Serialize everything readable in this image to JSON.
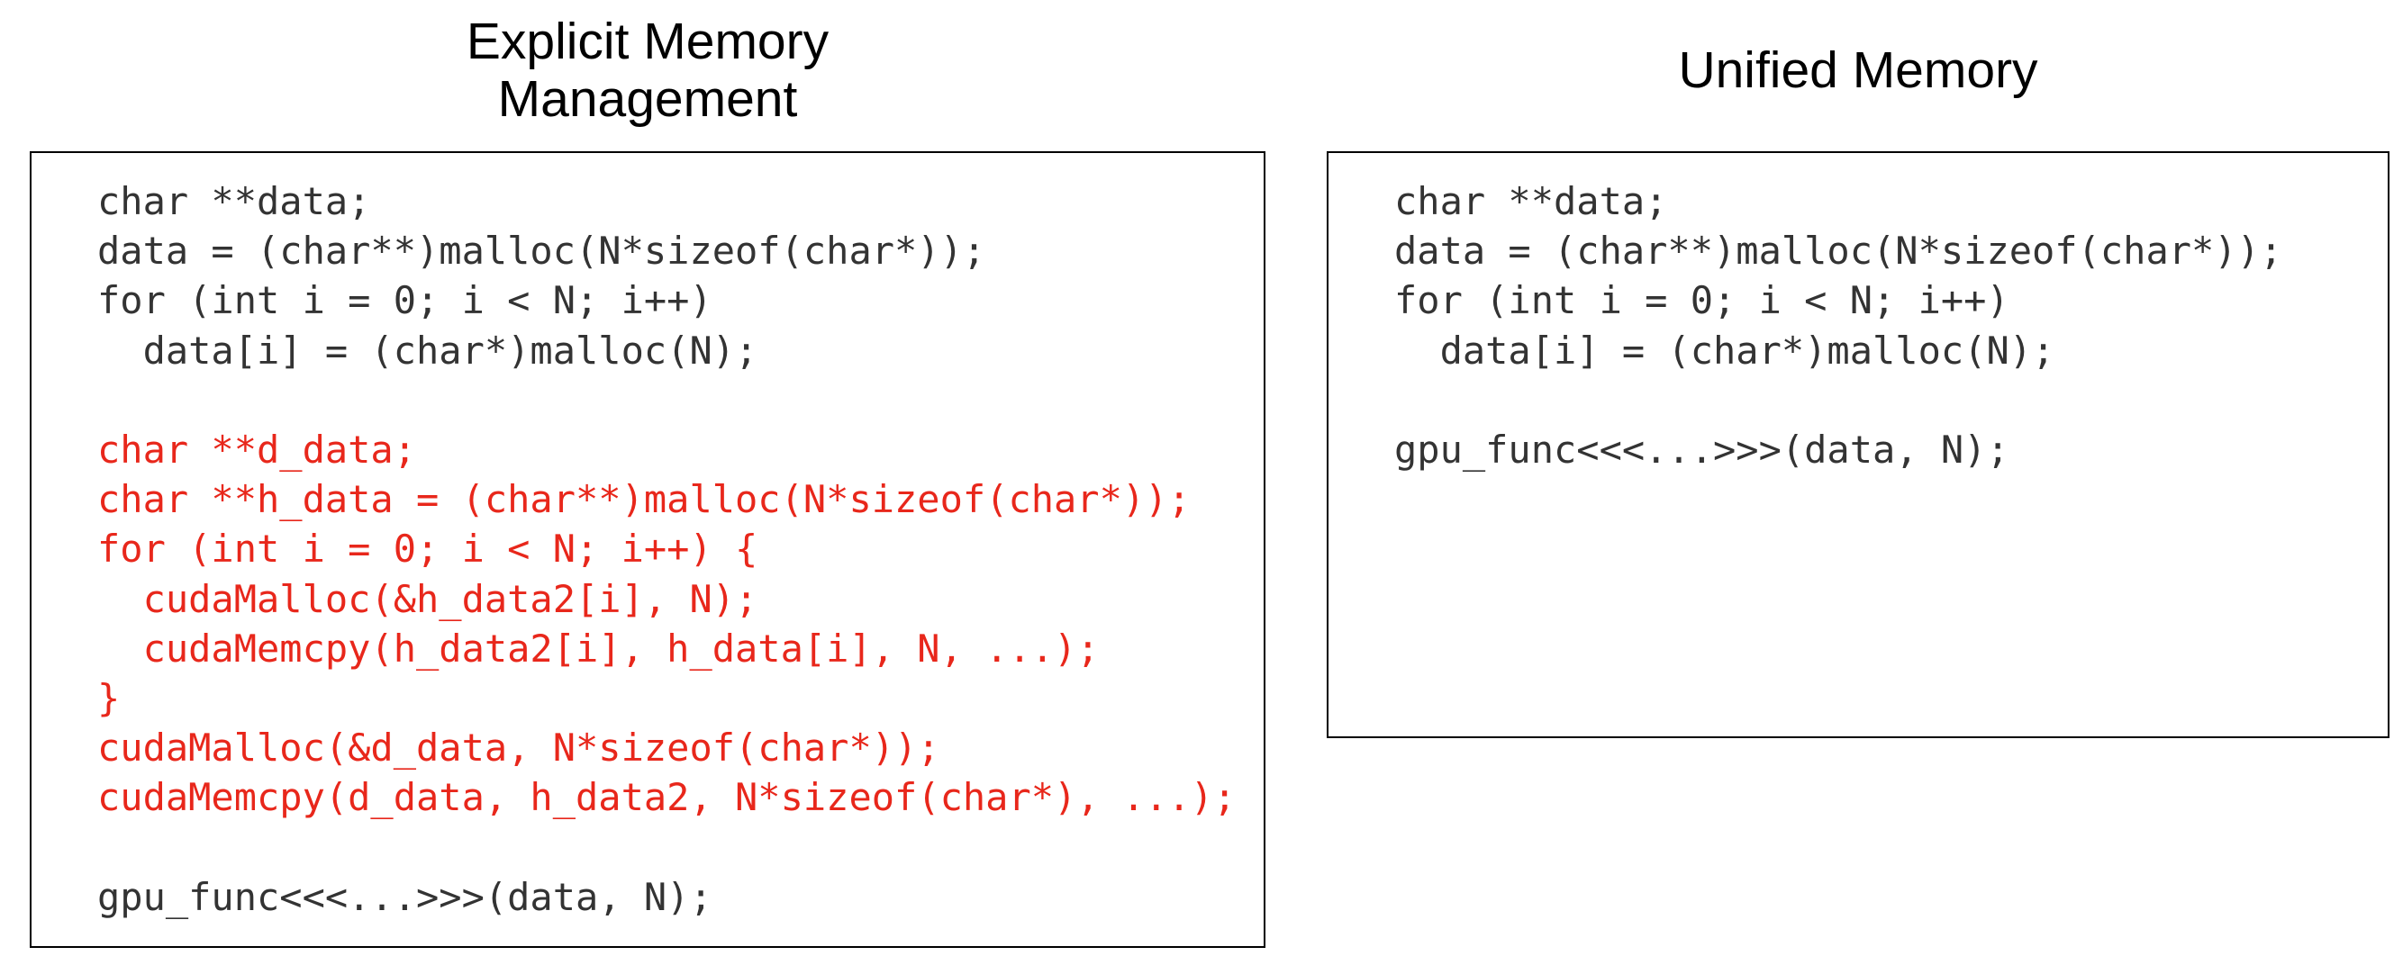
{
  "panels": {
    "explicit": {
      "title": "Explicit Memory\nManagement",
      "lines": [
        {
          "text": "char **data;",
          "highlight": false
        },
        {
          "text": "data = (char**)malloc(N*sizeof(char*));",
          "highlight": false
        },
        {
          "text": "for (int i = 0; i < N; i++)",
          "highlight": false
        },
        {
          "text": "  data[i] = (char*)malloc(N);",
          "highlight": false
        },
        {
          "text": "",
          "highlight": false
        },
        {
          "text": "char **d_data;",
          "highlight": true
        },
        {
          "text": "char **h_data = (char**)malloc(N*sizeof(char*));",
          "highlight": true
        },
        {
          "text": "for (int i = 0; i < N; i++) {",
          "highlight": true
        },
        {
          "text": "  cudaMalloc(&h_data2[i], N);",
          "highlight": true
        },
        {
          "text": "  cudaMemcpy(h_data2[i], h_data[i], N, ...);",
          "highlight": true
        },
        {
          "text": "}",
          "highlight": true
        },
        {
          "text": "cudaMalloc(&d_data, N*sizeof(char*));",
          "highlight": true
        },
        {
          "text": "cudaMemcpy(d_data, h_data2, N*sizeof(char*), ...);",
          "highlight": true
        },
        {
          "text": "",
          "highlight": false
        },
        {
          "text": "gpu_func<<<...>>>(data, N);",
          "highlight": false
        }
      ]
    },
    "unified": {
      "title": "Unified Memory",
      "lines": [
        {
          "text": "char **data;",
          "highlight": false
        },
        {
          "text": "data = (char**)malloc(N*sizeof(char*));",
          "highlight": false
        },
        {
          "text": "for (int i = 0; i < N; i++)",
          "highlight": false
        },
        {
          "text": "  data[i] = (char*)malloc(N);",
          "highlight": false
        },
        {
          "text": "",
          "highlight": false
        },
        {
          "text": "gpu_func<<<...>>>(data, N);",
          "highlight": false
        }
      ]
    }
  },
  "colors": {
    "code_text": "#333333",
    "highlight_text": "#e8271b",
    "border": "#000000",
    "title_text": "#000000"
  }
}
